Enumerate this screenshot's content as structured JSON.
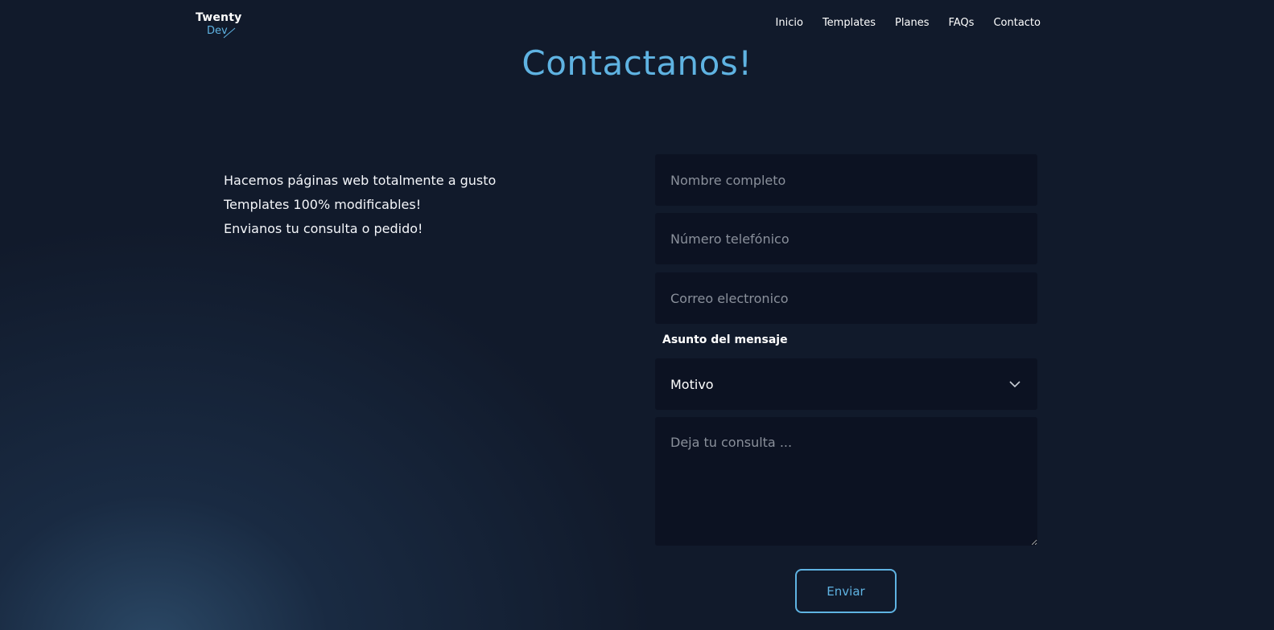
{
  "brand": {
    "name_line1": "Twenty",
    "name_line2": "Dev"
  },
  "nav": {
    "items": [
      {
        "label": "Inicio"
      },
      {
        "label": "Templates"
      },
      {
        "label": "Planes"
      },
      {
        "label": "FAQs"
      },
      {
        "label": "Contacto"
      }
    ]
  },
  "page": {
    "title": "Contactanos!"
  },
  "intro": {
    "lines": [
      "Hacemos páginas web totalmente a gusto",
      "Templates 100% modificables!",
      "Envianos tu consulta o pedido!"
    ]
  },
  "form": {
    "name_placeholder": "Nombre completo",
    "phone_placeholder": "Número telefónico",
    "email_placeholder": "Correo electronico",
    "subject_label": "Asunto del mensaje",
    "subject_value": "Motivo",
    "message_placeholder": "Deja tu consulta ...",
    "submit_label": "Enviar"
  },
  "colors": {
    "accent": "#5fb3e2",
    "background": "#111a2b",
    "field_background": "#0c1222"
  }
}
